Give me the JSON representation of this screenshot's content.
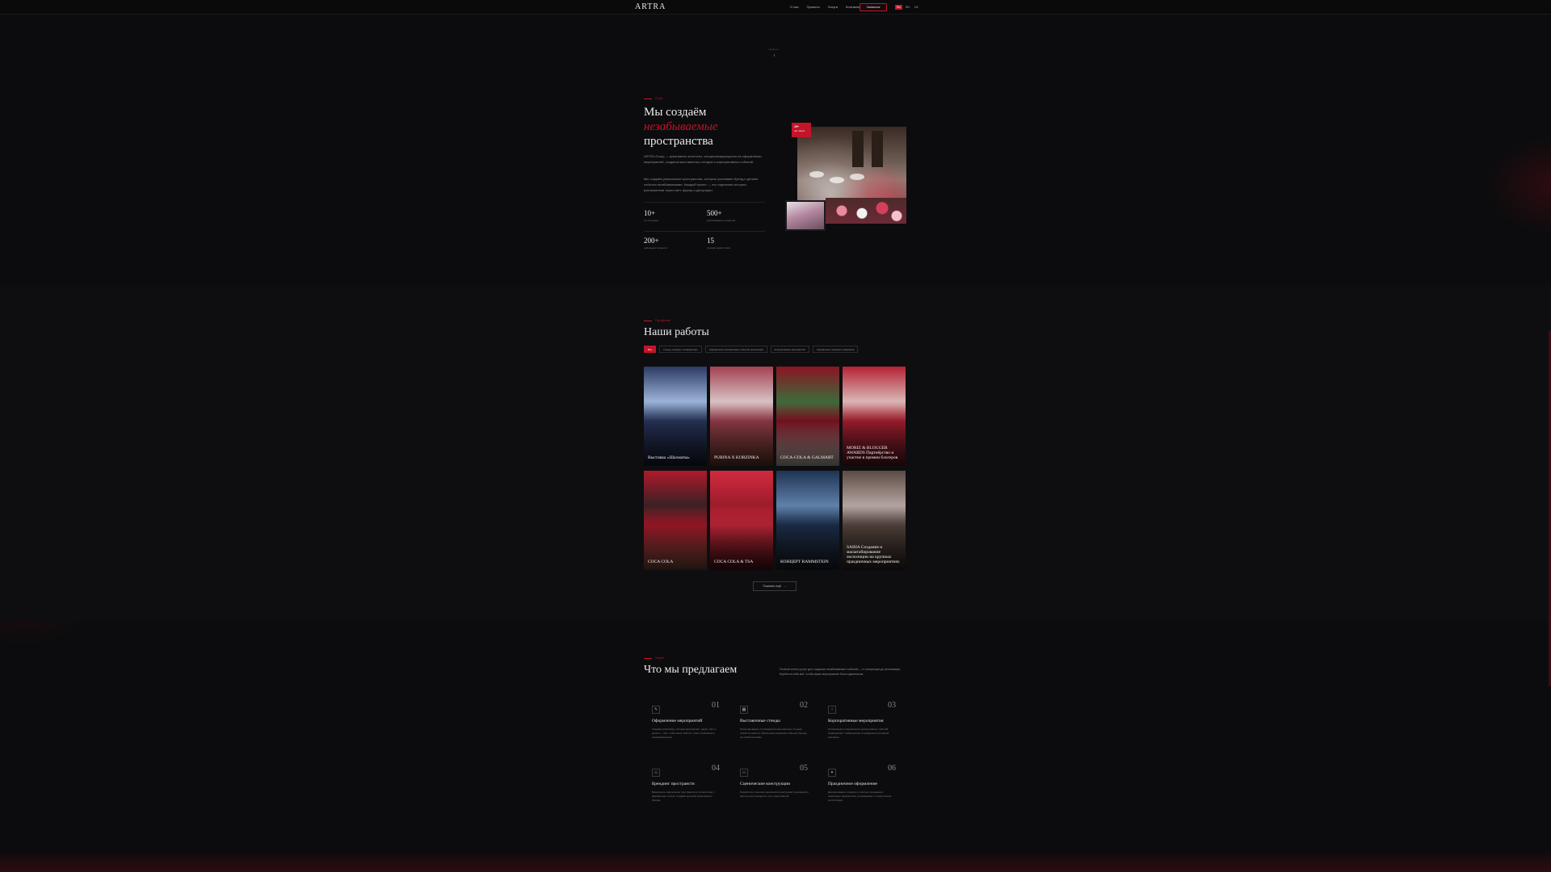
{
  "header": {
    "logo": "ARTRA",
    "nav": [
      "О нас",
      "Проекты",
      "Услуги",
      "Контакты"
    ],
    "contact_button": "Связаться",
    "langs": [
      "RU",
      "EN",
      "UZ"
    ]
  },
  "hero": {
    "scroll_label": "прокрутите",
    "eyebrow": "О нас",
    "title_line1": "Мы создаём",
    "title_accent": "незабываемые",
    "title_line3": "пространства",
    "paragraph1": "ARTRA Group — креативное агентство, специализирующееся на оформлении мероприятий, создании выставочных стендов и корпоративных событий.",
    "paragraph2": "Мы создаём уникальные пространства, которые усиливают бренд и делают события незабываемыми. Каждый проект — это отдельная история, рассказанная через свет, форму и декорации.",
    "stats": [
      {
        "num": "10+",
        "label": "лет на рынке"
      },
      {
        "num": "500+",
        "label": "реализованных проектов"
      },
      {
        "num": "200+",
        "label": "довольных клиентов"
      },
      {
        "num": "15",
        "label": "городов присутствия"
      }
    ],
    "badge_top": "10+",
    "badge_bottom": "лет опыта"
  },
  "works": {
    "eyebrow": "Портфолио",
    "title": "Наши работы",
    "filters": [
      "Все",
      "Стенды, форумы и конференции",
      "Оформление корпоративных событий, промоакций",
      "Корпоративные мероприятия",
      "Оформление городских праздников"
    ],
    "active_filter": 0,
    "cards": [
      {
        "caption": "Выставка «Шахматы»",
        "c1": "#2c3a63",
        "c2": "#9ab3d6",
        "c3": "#1a1f33"
      },
      {
        "caption": "PURINA X KORZINKA",
        "c1": "#a34152",
        "c2": "#d6c2c4",
        "c3": "#6a3b2c"
      },
      {
        "caption": "COCA-COLA & GALMART",
        "c1": "#8c1424",
        "c2": "#3e6a3a",
        "c3": "#c9c4b8"
      },
      {
        "caption": "MORIZ & BLOGGER AWARDS Партнёрство и участие в премии блогеров",
        "c1": "#b52234",
        "c2": "#d8b6b4",
        "c3": "#5c1620"
      },
      {
        "caption": "COCA COLA",
        "c1": "#b01a2b",
        "c2": "#3a2024",
        "c3": "#7c4d3d"
      },
      {
        "caption": "COCA COLA & TSA",
        "c1": "#d22a3f",
        "c2": "#9c1c2c",
        "c3": "#4d1016"
      },
      {
        "caption": "КОНЦЕРТ RAMMSTEIN",
        "c1": "#1e3352",
        "c2": "#5f80a8",
        "c3": "#1a1e28"
      },
      {
        "caption": "SAIHA Создание и масштабирование экспозиции на крупных праздничных мероприятиях",
        "c1": "#5c4b44",
        "c2": "#b3a3a0",
        "c3": "#2e2522"
      }
    ],
    "more_button": "Показать ещё"
  },
  "services": {
    "eyebrow": "Услуги",
    "title": "Что мы предлагаем",
    "description": "Полный спектр услуг для создания незабываемых событий — от концепции до реализации. Берём на себя всё, чтобы ваше мероприятие было идеальным.",
    "items": [
      {
        "n": "01",
        "title": "Оформление мероприятий",
        "icon": "✎",
        "desc": "Создаём атмосферу, которая вдохновляет: декор, свет и детали — всё, чтобы ваше событие стало особенным и запоминающимся."
      },
      {
        "n": "02",
        "title": "Выставочные стенды",
        "icon": "▦",
        "desc": "Проектирование и производство выставочных стендов любой сложности. Привлекаем внимание к вашему бренду на любой выставке."
      },
      {
        "n": "03",
        "title": "Корпоративные мероприятия",
        "icon": "♢",
        "desc": "Организация и оформление корпоративных событий, конференций, тимбилдингов и праздников для вашей компании."
      },
      {
        "n": "04",
        "title": "Брендинг пространств",
        "icon": "◇",
        "desc": "Визуальное оформление пространств в соответствии с фирменным стилем. Создаём цельный образ вашего бренда."
      },
      {
        "n": "05",
        "title": "Сценические конструкции",
        "icon": "▭",
        "desc": "Разработка и монтаж сценических конструкций, декораций и фотозон для концертов, шоу и фестивалей."
      },
      {
        "n": "06",
        "title": "Праздничное оформление",
        "icon": "✦",
        "desc": "Декорирование городских и частных праздников: новогоднее оформление, иллюминация и тематические инсталляции."
      }
    ]
  },
  "colors": {
    "accent": "#c3152a",
    "bg": "#0c0c0e"
  }
}
